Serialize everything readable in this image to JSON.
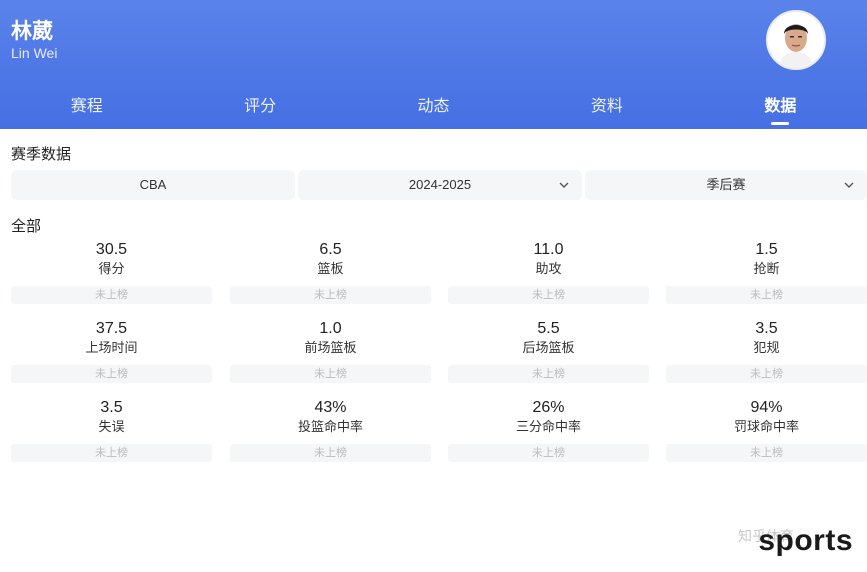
{
  "player": {
    "name": "林葳",
    "name_en": "Lin Wei"
  },
  "tabs": [
    {
      "label": "赛程",
      "active": false
    },
    {
      "label": "评分",
      "active": false
    },
    {
      "label": "动态",
      "active": false
    },
    {
      "label": "资料",
      "active": false
    },
    {
      "label": "数据",
      "active": true
    }
  ],
  "section_title": "赛季数据",
  "selectors": {
    "league": "CBA",
    "season": "2024-2025",
    "phase": "季后赛"
  },
  "group_title": "全部",
  "stats": [
    {
      "value": "30.5",
      "label": "得分",
      "rank": "未上榜"
    },
    {
      "value": "6.5",
      "label": "篮板",
      "rank": "未上榜"
    },
    {
      "value": "11.0",
      "label": "助攻",
      "rank": "未上榜"
    },
    {
      "value": "1.5",
      "label": "抢断",
      "rank": "未上榜"
    },
    {
      "value": "37.5",
      "label": "上场时间",
      "rank": "未上榜"
    },
    {
      "value": "1.0",
      "label": "前场篮板",
      "rank": "未上榜"
    },
    {
      "value": "5.5",
      "label": "后场篮板",
      "rank": "未上榜"
    },
    {
      "value": "3.5",
      "label": "犯规",
      "rank": "未上榜"
    },
    {
      "value": "3.5",
      "label": "失误",
      "rank": "未上榜"
    },
    {
      "value": "43%",
      "label": "投篮命中率",
      "rank": "未上榜"
    },
    {
      "value": "26%",
      "label": "三分命中率",
      "rank": "未上榜"
    },
    {
      "value": "94%",
      "label": "罚球命中率",
      "rank": "未上榜"
    }
  ],
  "watermark": {
    "faint": "知乎体育",
    "brand": "sports"
  },
  "colors": {
    "header": "#4d76e6",
    "accent": "#ffffff",
    "cell_bg": "#f5f6f8"
  }
}
